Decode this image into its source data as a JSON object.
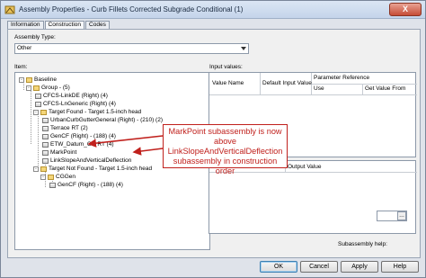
{
  "window": {
    "title": "Assembly Properties - Curb Fillets Corrected Subgrade Conditional (1)",
    "close_label": "X"
  },
  "tabs": [
    {
      "label": "Information"
    },
    {
      "label": "Construction"
    },
    {
      "label": "Codes"
    }
  ],
  "assembly_type": {
    "label": "Assembly Type:",
    "value": "Other"
  },
  "item": {
    "label": "Item:",
    "tree": [
      {
        "label": "Baseline",
        "expander": "-"
      },
      {
        "label": "Group - (5)",
        "expander": "-"
      },
      {
        "label": "CFCS-LinkDE (Right) (4)"
      },
      {
        "label": "CFCS-LnGeneric (Right) (4)"
      },
      {
        "label": "Target Found - Target 1.5-inch head",
        "expander": "-"
      },
      {
        "label": "UrbanCurbGutterGeneral (Right) - (210) (2)"
      },
      {
        "label": "Terrace RT (2)"
      },
      {
        "label": "GenCF (Right) - (188) (4)"
      },
      {
        "label": "ETW_Datum_CG RT (4)"
      },
      {
        "label": "MarkPoint"
      },
      {
        "label": "LinkSlopeAndVerticalDeflection"
      },
      {
        "label": "Target Not Found - Target 1.5-inch head",
        "expander": "-"
      },
      {
        "label": "CGGen",
        "expander": "-"
      },
      {
        "label": "GenCF (Right) - (188) (4)"
      }
    ]
  },
  "input_values": {
    "label": "Input values:",
    "col_value_name": "Value Name",
    "col_default_input": "Default Input Value",
    "col_param_ref": "Parameter Reference",
    "col_use": "Use",
    "col_get_value_from": "Get Value From"
  },
  "output_values": {
    "col_value_name": "Value Name",
    "col_output_value": "Output Value"
  },
  "subassembly_help": {
    "label": "Subassembly help:",
    "button": "…"
  },
  "buttons": {
    "ok": "OK",
    "cancel": "Cancel",
    "apply": "Apply",
    "help": "Help"
  },
  "annotation": {
    "text_lines": [
      "MarkPoint subassembly is now",
      "above",
      "LinkSlopeAndVerticalDeflection",
      "subassembly in construction order"
    ],
    "color": "#c0201c"
  }
}
